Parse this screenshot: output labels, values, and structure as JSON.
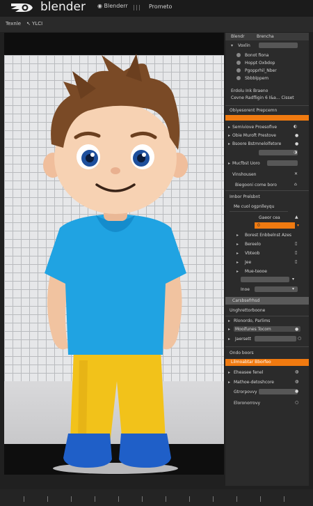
{
  "app": {
    "brand": "blender",
    "menu": [
      "Blenderr",
      "Prometo"
    ]
  },
  "toolbar": {
    "items": [
      "Texnle",
      "YLCI"
    ]
  },
  "panel": {
    "tabs": [
      "Blendr",
      "Brencha"
    ],
    "group1": {
      "field_label": "Voxlin",
      "items": [
        "Bonot fiona",
        "Hoppt Oxbdop",
        "Pgopprhil_Nber",
        "Sbbblppem"
      ]
    },
    "info": {
      "line1": "Erdolu Ink Braeno",
      "line2": "Cevne Radfligin 6 I&a... Cisset"
    },
    "section1": {
      "title": "Obiyesorent Prepcemn"
    },
    "rows1": [
      {
        "label": "Semiviove Proesofive",
        "icon": "eye-icon"
      },
      {
        "label": "Obie Muroft Prestove",
        "icon": "dot-icon"
      },
      {
        "label": "Bsoore Bstmnelolfetore",
        "icon": "dot-icon"
      },
      {
        "label": "Mucfbst Uoro",
        "icon": "toggle-icon"
      },
      {
        "label": "Vinshousen",
        "icon": "cross-icon"
      },
      {
        "label": "Biegooni come boro",
        "icon": "trash-icon"
      }
    ],
    "section2": {
      "title": "Imbor Prelsbnt",
      "tab": "Me cuol ogpnlleyqu"
    },
    "orange_value": "0",
    "labels2": [
      "Gaeor cea",
      "Borest Enbbelnst Azes",
      "Bereelo",
      "Vbteob",
      "Jee",
      "Mue-teooe",
      "Inoe"
    ],
    "section3": {
      "title": "Carsbsefrhsd"
    },
    "section4": {
      "title": "Unghrettorboone",
      "rows": [
        "Rlonordo, Parlims",
        "Mooifunes Tocom",
        "Jaersett"
      ]
    },
    "section5": {
      "title": "Ondo boors",
      "highlight": "Lilmoabtar Bborfeo",
      "rows": [
        "Eheasee fenel",
        "Mathoe-detoshcore",
        "Gtrorpovvy",
        "Eloronorrovy"
      ]
    }
  },
  "colors": {
    "accent": "#f07a10",
    "background": "#202020",
    "panel": "#2b2b2b"
  }
}
